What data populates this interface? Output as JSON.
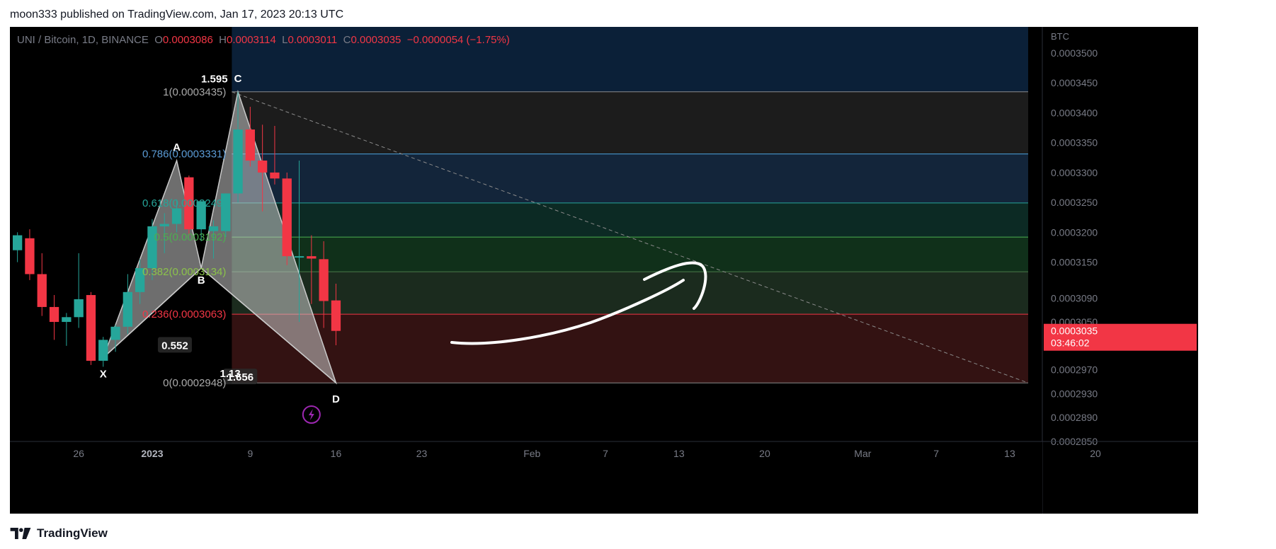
{
  "header": {
    "published": "moon333 published on TradingView.com, Jan 17, 2023 20:13 UTC"
  },
  "legend": {
    "symbol": "UNI / Bitcoin, 1D, BINANCE",
    "o_label": "O",
    "o": "0.0003086",
    "h_label": "H",
    "h": "0.0003114",
    "l_label": "L",
    "l": "0.0003011",
    "c_label": "C",
    "c": "0.0003035",
    "change": "−0.0000054 (−1.75%)"
  },
  "footer": {
    "brand": "TradingView"
  },
  "colors": {
    "up": "#26a69a",
    "down": "#f23645",
    "background": "#000000",
    "price_tag": "#f23645",
    "harmonic_fill": "#c9c9c9",
    "signal_icon": "#9c27b0"
  },
  "chart_data": {
    "type": "candlestick",
    "y_axis": {
      "unit": "BTC",
      "ticks": [
        "0.0003500",
        "0.0003450",
        "0.0003400",
        "0.0003350",
        "0.0003300",
        "0.0003250",
        "0.0003200",
        "0.0003150",
        "0.0003090",
        "0.0003050",
        "0.0002970",
        "0.0002930",
        "0.0002890",
        "0.0002850"
      ],
      "ylim": [
        0.000285,
        0.000352
      ]
    },
    "x_axis": {
      "ticks": [
        "26",
        "2023",
        "9",
        "16",
        "23",
        "Feb",
        "7",
        "13",
        "20",
        "Mar",
        "7",
        "13",
        "20"
      ]
    },
    "last_price": {
      "value": "0.0003035",
      "countdown": "03:46:02"
    },
    "candles": [
      {
        "o": 0.000317,
        "h": 0.00032,
        "l": 0.000315,
        "c": 0.0003195
      },
      {
        "o": 0.000319,
        "h": 0.0003205,
        "l": 0.000312,
        "c": 0.000313
      },
      {
        "o": 0.000313,
        "h": 0.0003165,
        "l": 0.000306,
        "c": 0.0003075
      },
      {
        "o": 0.0003075,
        "h": 0.0003095,
        "l": 0.000302,
        "c": 0.000305
      },
      {
        "o": 0.000305,
        "h": 0.0003065,
        "l": 0.000301,
        "c": 0.0003058
      },
      {
        "o": 0.0003058,
        "h": 0.0003165,
        "l": 0.000304,
        "c": 0.0003088
      },
      {
        "o": 0.0003095,
        "h": 0.00031,
        "l": 0.0002978,
        "c": 0.0002985
      },
      {
        "o": 0.0002985,
        "h": 0.0003025,
        "l": 0.0002975,
        "c": 0.000302
      },
      {
        "o": 0.000302,
        "h": 0.0003045,
        "l": 0.0003,
        "c": 0.0003042
      },
      {
        "o": 0.0003042,
        "h": 0.000313,
        "l": 0.000303,
        "c": 0.00031
      },
      {
        "o": 0.00031,
        "h": 0.0003155,
        "l": 0.000308,
        "c": 0.000314
      },
      {
        "o": 0.000314,
        "h": 0.0003222,
        "l": 0.000312,
        "c": 0.000321
      },
      {
        "o": 0.000321,
        "h": 0.0003232,
        "l": 0.0003165,
        "c": 0.0003214
      },
      {
        "o": 0.0003214,
        "h": 0.0003255,
        "l": 0.00032,
        "c": 0.000324
      },
      {
        "o": 0.0003292,
        "h": 0.0003295,
        "l": 0.0003195,
        "c": 0.0003205
      },
      {
        "o": 0.0003205,
        "h": 0.0003252,
        "l": 0.0003185,
        "c": 0.0003252
      },
      {
        "o": 0.0003202,
        "h": 0.000322,
        "l": 0.0003156,
        "c": 0.000321
      },
      {
        "o": 0.0003202,
        "h": 0.0003265,
        "l": 0.0003192,
        "c": 0.0003265
      },
      {
        "o": 0.0003265,
        "h": 0.0003435,
        "l": 0.000325,
        "c": 0.0003372
      },
      {
        "o": 0.0003372,
        "h": 0.000341,
        "l": 0.000331,
        "c": 0.000332
      },
      {
        "o": 0.000332,
        "h": 0.000338,
        "l": 0.0003235,
        "c": 0.00033
      },
      {
        "o": 0.00033,
        "h": 0.0003378,
        "l": 0.000328,
        "c": 0.000329
      },
      {
        "o": 0.000329,
        "h": 0.00033,
        "l": 0.0003145,
        "c": 0.000316
      },
      {
        "o": 0.000316,
        "h": 0.000332,
        "l": 0.000305,
        "c": 0.000316
      },
      {
        "o": 0.000316,
        "h": 0.0003195,
        "l": 0.000308,
        "c": 0.0003156
      },
      {
        "o": 0.0003155,
        "h": 0.0003185,
        "l": 0.000304,
        "c": 0.0003085
      },
      {
        "o": 0.0003086,
        "h": 0.0003114,
        "l": 0.0003011,
        "c": 0.0003035
      }
    ],
    "fib_levels": [
      {
        "ratio": "1",
        "value": "0.0003435",
        "label": "1(0.0003435)"
      },
      {
        "ratio": "0.786",
        "value": "0.0003331",
        "label": "0.786(0.0003331)"
      },
      {
        "ratio": "0.618",
        "value": "0.0003249",
        "label": "0.618(0.0003249)"
      },
      {
        "ratio": "0.5",
        "value": "0.0003192",
        "label": "0.5(0.0003192)"
      },
      {
        "ratio": "0.382",
        "value": "0.0003134",
        "label": "0.382(0.0003134)"
      },
      {
        "ratio": "0.236",
        "value": "0.0003063",
        "label": "0.236(0.0003063)"
      },
      {
        "ratio": "0",
        "value": "0.0002948",
        "label": "0(0.0002948)"
      }
    ],
    "harmonic_points": {
      "X": {
        "bar": 7,
        "price": 0.000299
      },
      "A": {
        "bar": 13,
        "price": 0.000332
      },
      "B": {
        "bar": 15,
        "price": 0.000314
      },
      "C": {
        "bar": 18,
        "price": 0.0003435
      },
      "D": {
        "bar": 26,
        "price": 0.0002948
      }
    },
    "point_labels": [
      "X",
      "A",
      "B",
      "C",
      "D"
    ],
    "ratio_labels": [
      "1.595",
      "0.552",
      "1.656",
      "1.13"
    ]
  }
}
